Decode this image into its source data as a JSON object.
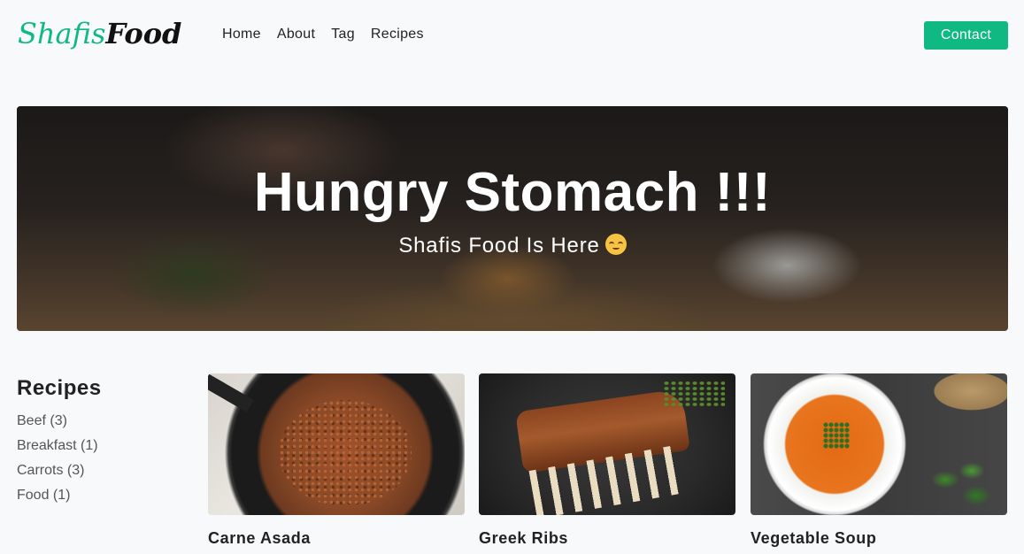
{
  "nav": {
    "logo_part1": "Shafis",
    "logo_part2": "Food",
    "links": [
      "Home",
      "About",
      "Tag",
      "Recipes"
    ],
    "contact_label": "Contact"
  },
  "hero": {
    "title": "Hungry Stomach !!!",
    "subtitle": "Shafis Food Is Here"
  },
  "sidebar": {
    "title": "Recipes",
    "tags": [
      "Beef (3)",
      "Breakfast (1)",
      "Carrots (3)",
      "Food (1)"
    ]
  },
  "recipes": [
    {
      "title": "Carne Asada"
    },
    {
      "title": "Greek Ribs"
    },
    {
      "title": "Vegetable Soup"
    }
  ],
  "colors": {
    "accent": "#10b981",
    "background": "#f8f9fb",
    "text": "#222222"
  }
}
